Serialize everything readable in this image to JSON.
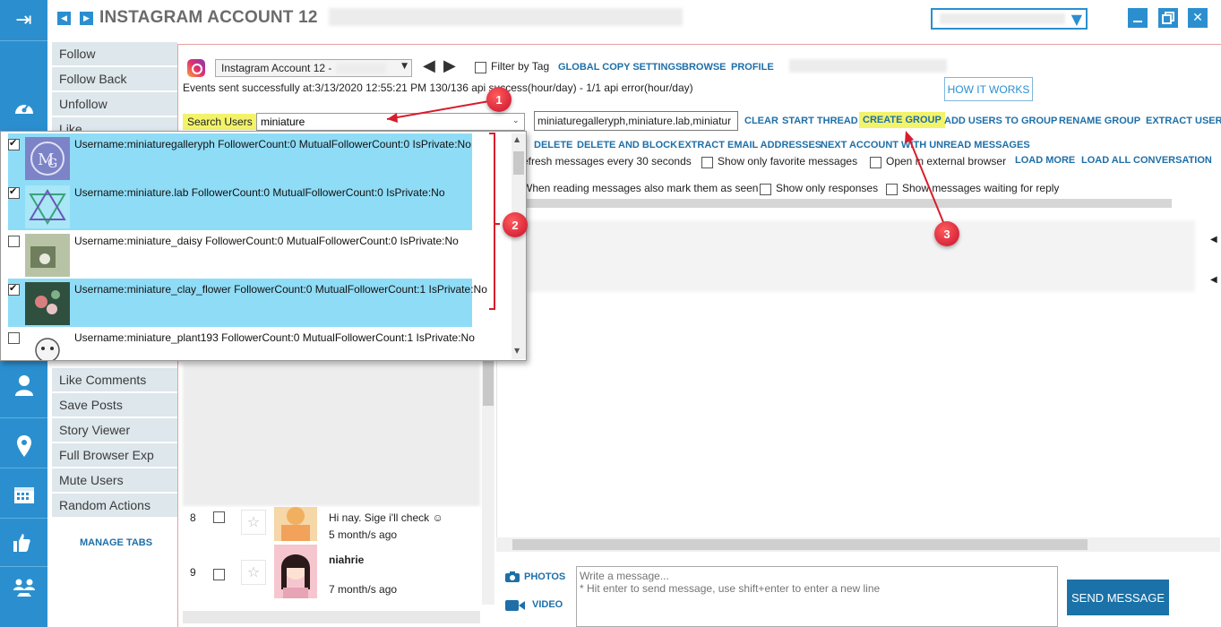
{
  "window": {
    "title": "INSTAGRAM ACCOUNT 12",
    "account_select_value": "",
    "account_select_arrow": "▼"
  },
  "rail": {
    "icons": [
      "login-icon",
      "dashboard-icon",
      "user-icon",
      "location-icon",
      "calendar-icon",
      "thumbs-icon",
      "group-icon"
    ]
  },
  "menu": {
    "items": [
      "Follow",
      "Follow Back",
      "Unfollow",
      "Like",
      "Like Comments",
      "Save Posts",
      "Story Viewer",
      "Full Browser Exp",
      "Mute Users",
      "Random Actions"
    ],
    "manage_tabs": "MANAGE TABS"
  },
  "toolbar": {
    "account_combo": "Instagram Account 12 -",
    "filter_by_tag": "Filter by Tag",
    "global_copy_settings": "GLOBAL COPY SETTINGS",
    "browse": "BROWSE",
    "profile": "PROFILE",
    "status": "Events sent successfully at:3/13/2020 12:55:21 PM 130/136 api success(hour/day) -  1/1 api error(hour/day)",
    "how_it_works": "HOW IT WORKS"
  },
  "search": {
    "label": "Search Users",
    "value": "miniature",
    "selected": "miniaturegalleryph,miniature.lab,miniatur"
  },
  "actions": {
    "clear": "CLEAR",
    "start_thread": "START THREAD",
    "create_group": "CREATE GROUP",
    "add_users_to_group": "ADD USERS TO GROUP",
    "rename_group": "RENAME GROUP",
    "extract_users": "EXTRACT USERI",
    "delete": "DELETE",
    "delete_and_block": "DELETE AND BLOCK",
    "extract_emails": "EXTRACT EMAIL ADDRESSES",
    "next_account": "NEXT ACCOUNT WITH UNREAD MESSAGES",
    "load_more": "LOAD MORE",
    "load_all": "LOAD ALL CONVERSATION"
  },
  "options": {
    "refresh": "efresh messages every 30 seconds",
    "favorites": "Show only favorite messages",
    "external_browser": "Open in external browser",
    "mark_read": "When reading messages also mark them as seen",
    "responses": "Show only responses",
    "waiting_reply": "Show messages waiting for reply"
  },
  "results": [
    {
      "text": "Username:miniaturegalleryph FollowerCount:0 MutualFollowerCount:0 IsPrivate:No",
      "checked": true
    },
    {
      "text": "Username:miniature.lab FollowerCount:0 MutualFollowerCount:0 IsPrivate:No",
      "checked": true
    },
    {
      "text": "Username:miniature_daisy FollowerCount:0 MutualFollowerCount:0 IsPrivate:No",
      "checked": false
    },
    {
      "text": "Username:miniature_clay_flower FollowerCount:0 MutualFollowerCount:1 IsPrivate:No",
      "checked": true
    },
    {
      "text": "Username:miniature_plant193 FollowerCount:0 MutualFollowerCount:1 IsPrivate:No",
      "checked": false
    }
  ],
  "conversations": [
    {
      "num": "8",
      "name": "Hi nay. Sige i'll check ☺",
      "time": "5 month/s ago",
      "bold": false
    },
    {
      "num": "9",
      "name": "niahrie",
      "time": "7 month/s ago",
      "bold": true
    }
  ],
  "composer": {
    "photos": "PHOTOS",
    "video": "VIDEO",
    "placeholder": "Write a message...\n* Hit enter to send message, use shift+enter to enter a new line",
    "send": "SEND MESSAGE"
  },
  "markers": [
    "1",
    "2",
    "3"
  ],
  "colors": {
    "accent": "#2b8fcf",
    "highlight_yellow": "#f3f36a",
    "selected_row": "#8fdcf6",
    "marker_red": "#d0102e"
  }
}
